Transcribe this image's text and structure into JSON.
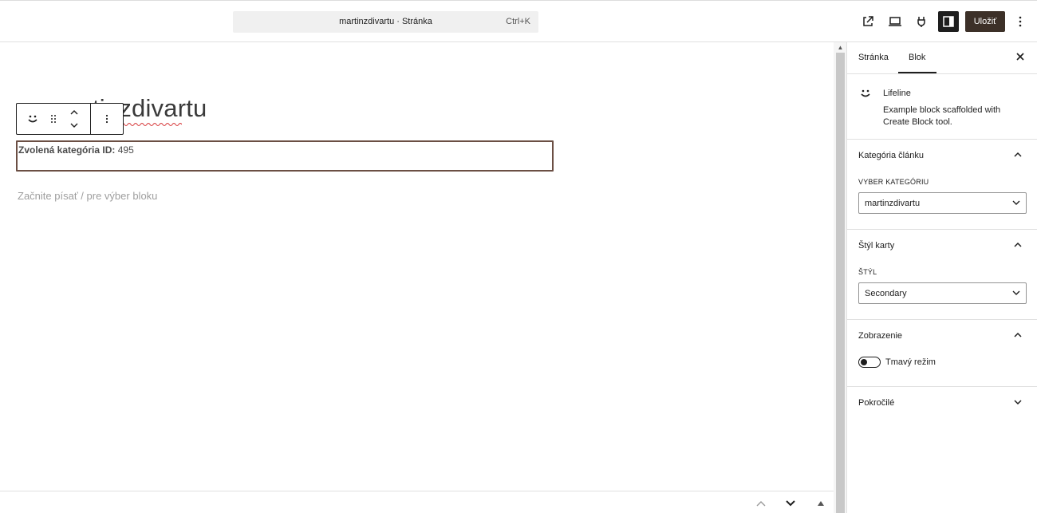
{
  "topbar": {
    "document_title": "martinzdivartu · Stránka",
    "shortcut": "Ctrl+K",
    "save_label": "Uložiť"
  },
  "editor": {
    "page_title": "martinzdivartu",
    "selected_block": {
      "label": "Zvolená kategória ID:",
      "value": "495"
    },
    "placeholder": "Začnite písať / pre výber bloku"
  },
  "sidebar": {
    "tabs": [
      "Stránka",
      "Blok"
    ],
    "active_tab": "Blok",
    "block": {
      "name": "Lifeline",
      "description": "Example block scaffolded with Create Block tool."
    },
    "panels": {
      "category": {
        "title": "Kategória článku",
        "field_label": "VYBER KATEGÓRIU",
        "selected": "martinzdivartu"
      },
      "card_style": {
        "title": "Štýl karty",
        "field_label": "ŠTÝL",
        "selected": "Secondary"
      },
      "display": {
        "title": "Zobrazenie",
        "toggle_label": "Tmavý režim",
        "toggle_on": false
      },
      "advanced": {
        "title": "Pokročilé"
      }
    }
  },
  "colors": {
    "save_button": "#3c3028",
    "selected_block_border": "#6b4f44",
    "toggle_active": "#1e1e1e"
  }
}
